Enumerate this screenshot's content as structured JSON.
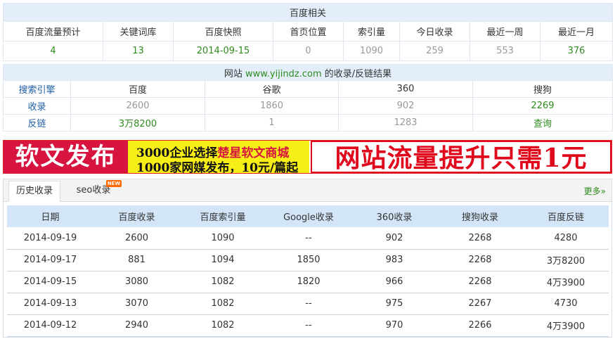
{
  "baidu": {
    "caption": "百度相关",
    "headers": [
      "百度流量预计",
      "关键词库",
      "百度快照",
      "首页位置",
      "索引量",
      "今日收录",
      "最近一周",
      "最近一月"
    ],
    "values": [
      "4",
      "13",
      "2014-09-15",
      "0",
      "1090",
      "259",
      "553",
      "376"
    ]
  },
  "engines": {
    "caption_prefix": "网站",
    "site": "www.yijindz.com",
    "caption_suffix": "的收录/反链结果",
    "corner": "搜索引擎",
    "columns": [
      "百度",
      "谷歌",
      "360",
      "搜狗"
    ],
    "rows": [
      {
        "label": "收录",
        "cells": [
          "2600",
          "1860",
          "902",
          "2269"
        ]
      },
      {
        "label": "反链",
        "cells": [
          "3万8200",
          "1",
          "1283",
          "查询"
        ]
      }
    ]
  },
  "banner": {
    "left": "软文发布",
    "mid_line1_a": "3000企业选择",
    "mid_line1_b": "楚星软文商城",
    "mid_line2": "1000家网媒发布，10元/篇起",
    "right": "网站流量提升只需1元"
  },
  "tabs": {
    "history": "历史收录",
    "seo": "seo收录",
    "badge": "NEW",
    "more": "更多»"
  },
  "history": {
    "headers": [
      "日期",
      "百度收录",
      "百度索引量",
      "Google收录",
      "360收录",
      "搜狗收录",
      "百度反链"
    ],
    "rows": [
      [
        "2014-09-19",
        "2600",
        "1090",
        "--",
        "902",
        "2268",
        "4280"
      ],
      [
        "2014-09-17",
        "881",
        "1094",
        "1850",
        "983",
        "2268",
        "3万8200"
      ],
      [
        "2014-09-15",
        "3080",
        "1082",
        "1820",
        "966",
        "2268",
        "4万3900"
      ],
      [
        "2014-09-13",
        "3070",
        "1082",
        "--",
        "975",
        "2267",
        "4730"
      ],
      [
        "2014-09-12",
        "2940",
        "1082",
        "--",
        "970",
        "2266",
        "4万3900"
      ]
    ]
  },
  "colors": {
    "green": "#2e8b1e",
    "link_blue": "#1f5fa8",
    "header_bg": "#e3eefa",
    "banner_red": "#d6143f",
    "banner_yellow": "#f7ee17"
  }
}
